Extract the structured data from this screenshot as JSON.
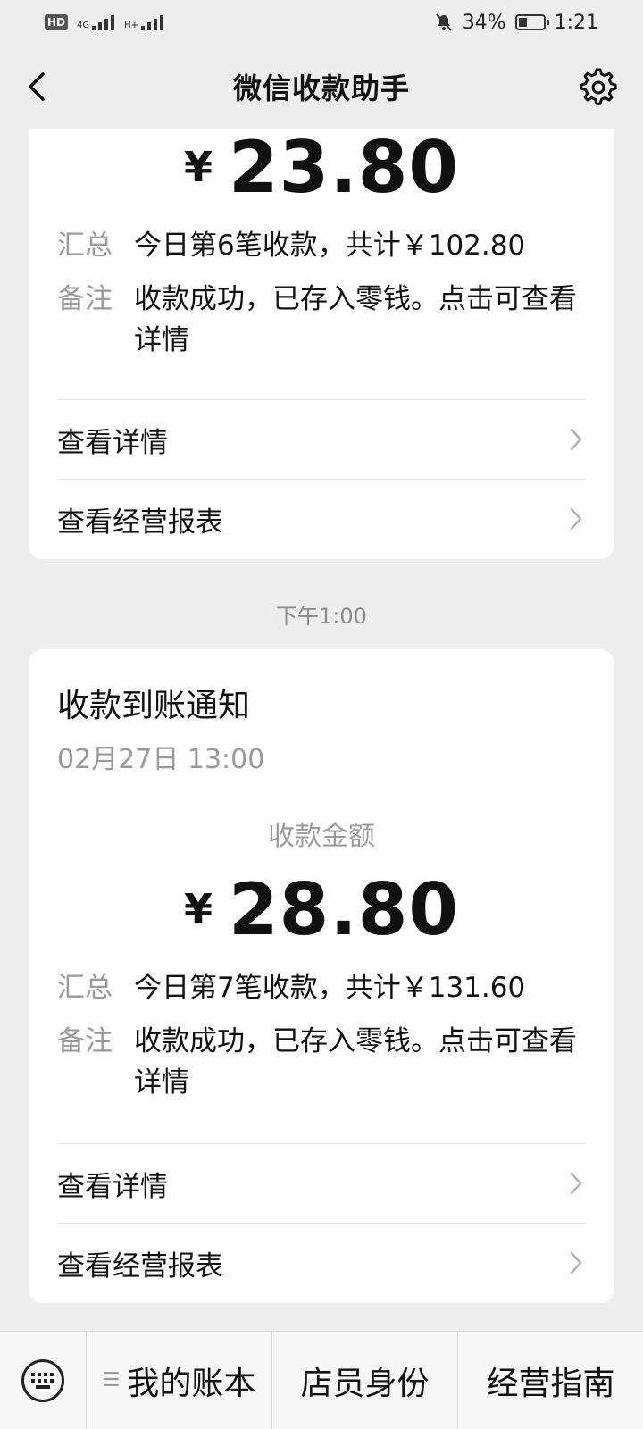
{
  "status_bar": {
    "hd": "HD",
    "net1": "4G",
    "net2": "H+",
    "battery_percent": "34%",
    "battery_level": 0.34,
    "time": "1:21"
  },
  "nav": {
    "title": "微信收款助手",
    "back_icon": "chevron-left-icon",
    "settings_icon": "gear-icon"
  },
  "messages": [
    {
      "amount_yen": "¥",
      "amount": "23.80",
      "summary_label": "汇总",
      "summary_value": "今日第6笔收款，共计￥102.80",
      "note_label": "备注",
      "note_value": "收款成功，已存入零钱。点击可查看详情",
      "link_details": "查看详情",
      "link_report": "查看经营报表"
    },
    {
      "title": "收款到账通知",
      "date": "02月27日 13:00",
      "amount_label": "收款金额",
      "amount_yen": "¥",
      "amount": "28.80",
      "summary_label": "汇总",
      "summary_value": "今日第7笔收款，共计￥131.60",
      "note_label": "备注",
      "note_value": "收款成功，已存入零钱。点击可查看详情",
      "link_details": "查看详情",
      "link_report": "查看经营报表"
    }
  ],
  "timestamp": "下午1:00",
  "bottom_menu": {
    "keyboard_icon": "keyboard-icon",
    "item1": "我的账本",
    "item2": "店员身份",
    "item3": "经营指南"
  },
  "colors": {
    "background": "#ededed",
    "card": "#ffffff",
    "muted": "#999999"
  }
}
